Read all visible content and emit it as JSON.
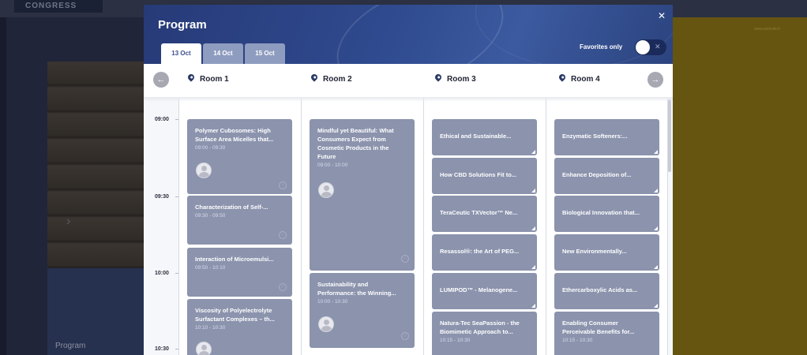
{
  "background": {
    "logo_text": "CONGRESS",
    "left_label": "Program",
    "right_link": "www.website.it"
  },
  "modal": {
    "title": "Program",
    "close_icon": "close-icon",
    "tabs": [
      {
        "label": "13 Oct",
        "active": true
      },
      {
        "label": "14 Oct",
        "active": false
      },
      {
        "label": "15 Oct",
        "active": false
      }
    ],
    "favorites_label": "Favorites only",
    "favorites_enabled": false
  },
  "rooms": [
    {
      "label": "Room 1"
    },
    {
      "label": "Room 2"
    },
    {
      "label": "Room 3"
    },
    {
      "label": "Room 4"
    }
  ],
  "times": [
    "09:00",
    "09:30",
    "10:00",
    "10:30"
  ],
  "sessions": {
    "room1": [
      {
        "title": "Polymer Cubosomes: High Surface Area Micelles that...",
        "time": "09:00 - 09:30"
      },
      {
        "title": "Characterization of Self-...",
        "time": "09:30 - 09:50"
      },
      {
        "title": "Interaction of Microemulsi...",
        "time": "09:50 - 10:10"
      },
      {
        "title": "Viscosity of Polyelectrolyte Surfactant Complexes – th...",
        "time": "10:10 - 10:30"
      }
    ],
    "room2": [
      {
        "title": "Mindful yet Beautiful: What Consumers Expect from Cosmetic Products in the Future",
        "time": "09:00 - 10:00"
      },
      {
        "title": "Sustainability and Performance: the Winning...",
        "time": "10:00 - 10:30"
      }
    ],
    "room3": [
      {
        "title": "Ethical and Sustainable..."
      },
      {
        "title": "How CBD Solutions Fit to..."
      },
      {
        "title": "TeraCeutic TXVector™ Ne..."
      },
      {
        "title": "Resassol®: the Art of PEG..."
      },
      {
        "title": "LUMIPOD™ - Melanogene..."
      },
      {
        "title": "Natura-Tec SeaPassion - the Biomimetic Approach to...",
        "time": "10:15 - 10:30"
      }
    ],
    "room4": [
      {
        "title": "Enzymatic Softeners:..."
      },
      {
        "title": "Enhance Deposition of..."
      },
      {
        "title": "Biological Innovation that..."
      },
      {
        "title": "New Environmentally..."
      },
      {
        "title": "Ethercarboxylic Acids as..."
      },
      {
        "title": "Enabling Consumer Perceivable Benefits for...",
        "time": "10:15 - 10:30"
      }
    ]
  }
}
